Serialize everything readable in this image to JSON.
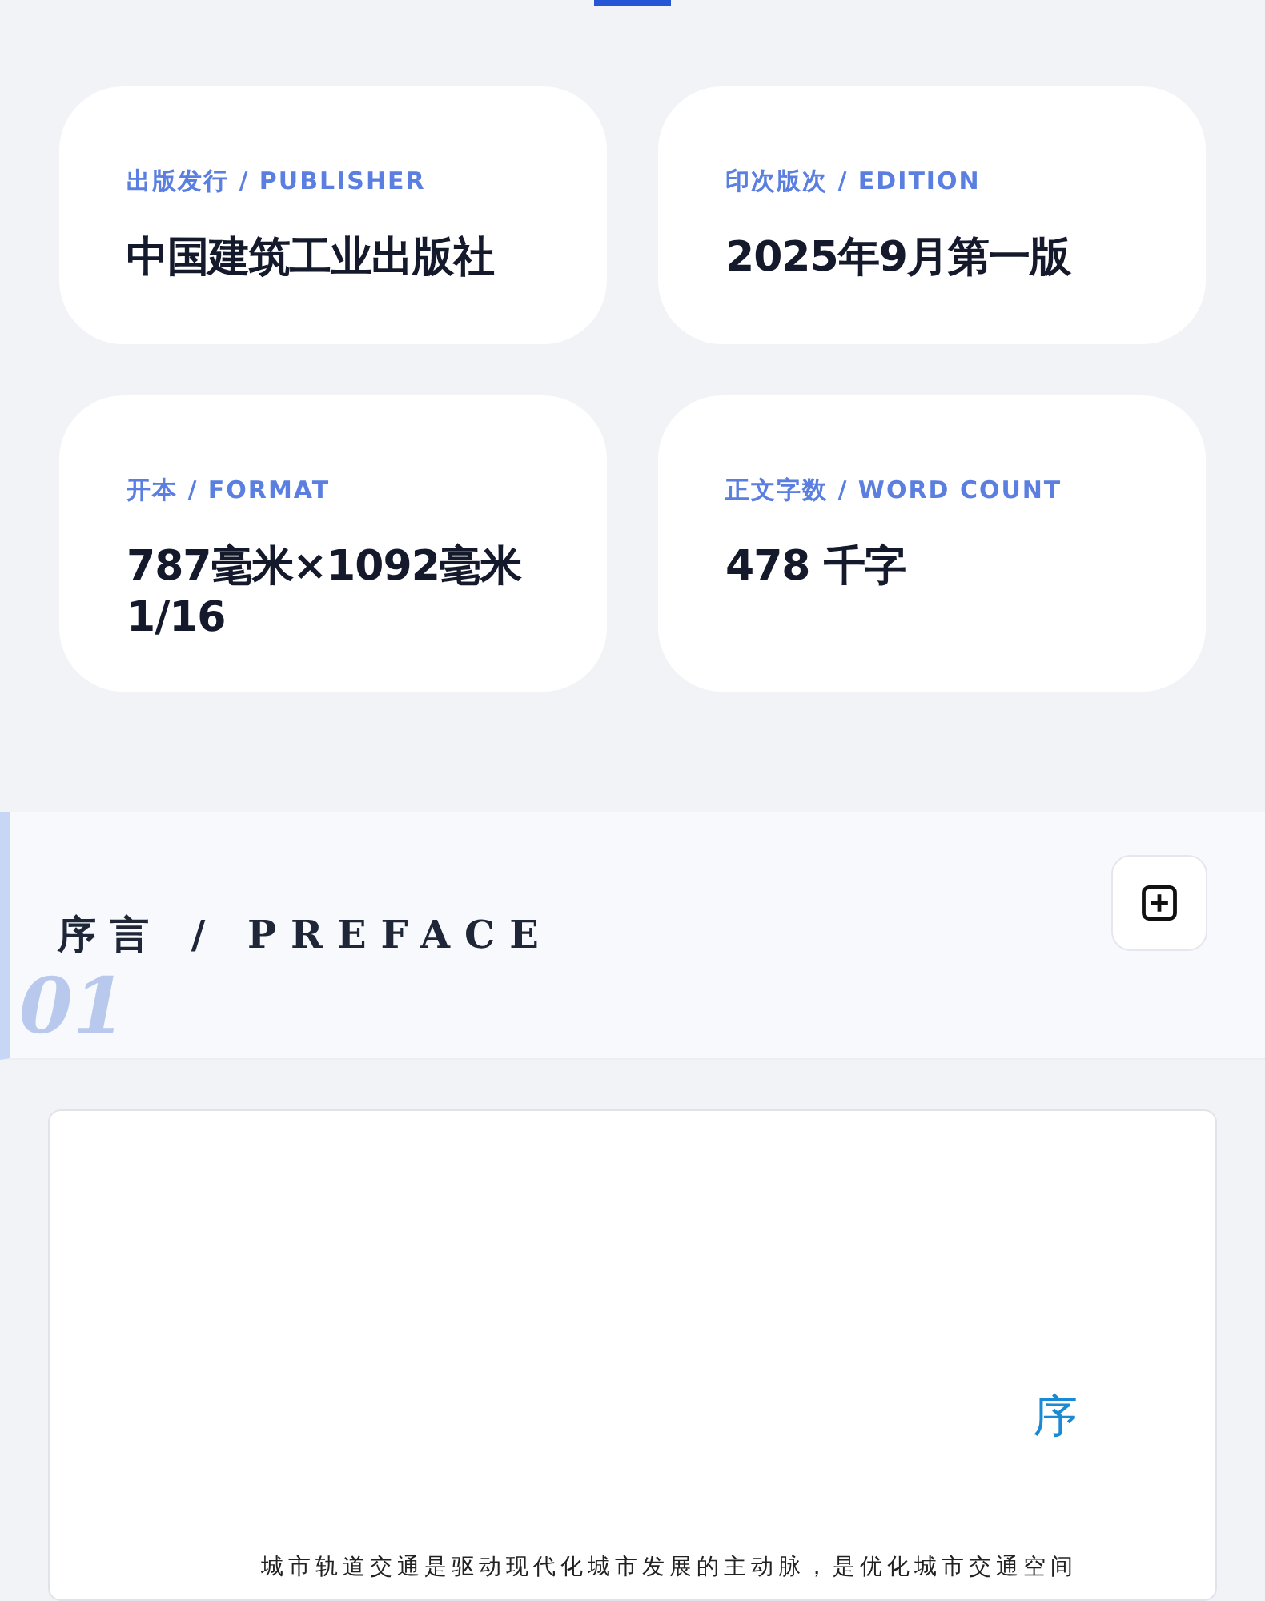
{
  "info_cards": [
    {
      "label": "出版发行 / PUBLISHER",
      "value": "中国建筑工业出版社"
    },
    {
      "label": "印次版次 / EDITION",
      "value": "2025年9月第一版"
    },
    {
      "label": "开本 / FORMAT",
      "value": "787毫米×1092毫米 1/16"
    },
    {
      "label": "正文字数 / WORD COUNT",
      "value": "478 千字"
    }
  ],
  "section": {
    "number": "01",
    "title": "序言 / PREFACE"
  },
  "document": {
    "heading": "序",
    "first_line": "城市轨道交通是驱动现代化城市发展的主动脉，是优化城市交通空间"
  }
}
